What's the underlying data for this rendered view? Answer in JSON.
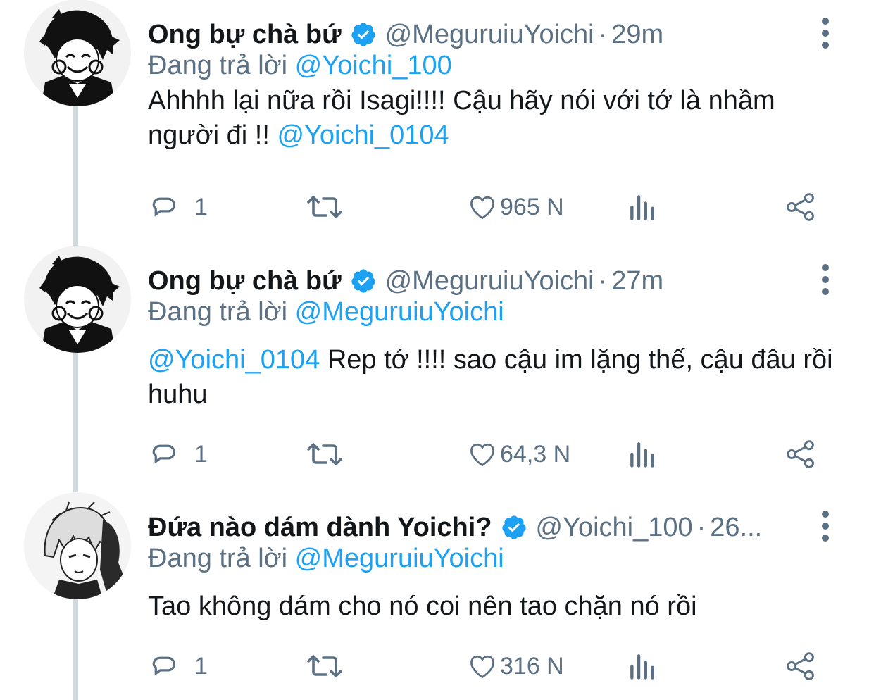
{
  "tweets": [
    {
      "display_name": "Ong bự chà bứ",
      "verified_icon": "verified-badge-icon",
      "handle": "@MeguruiuYoichi",
      "separator": "·",
      "time": "29m",
      "reply_prefix": "Đang trả lời",
      "reply_to": "@Yoichi_100",
      "body_text": "Ahhhh lại nữa rồi Isagi!!!! Cậu hãy nói với tớ là nhầm người đi !! ",
      "body_mention_leading": "",
      "body_mention_trailing": "@Yoichi_0104",
      "reply_count": "1",
      "retweet_count": "",
      "like_count": "965 N"
    },
    {
      "display_name": "Ong bự chà bứ",
      "verified_icon": "verified-badge-icon",
      "handle": "@MeguruiuYoichi",
      "separator": "·",
      "time": "27m",
      "reply_prefix": "Đang trả lời",
      "reply_to": "@MeguruiuYoichi",
      "body_mention_leading": "@Yoichi_0104",
      "body_text": " Rep tớ !!!! sao cậu im lặng thế, cậu đâu rồi huhu",
      "body_mention_trailing": "",
      "reply_count": "1",
      "retweet_count": "",
      "like_count": "64,3 N"
    },
    {
      "display_name": "Đứa nào dám dành Yoichi?",
      "verified_icon": "verified-badge-icon",
      "handle": "@Yoichi_100",
      "separator": "·",
      "time": "26...",
      "reply_prefix": "Đang trả lời",
      "reply_to": "@MeguruiuYoichi",
      "body_mention_leading": "",
      "body_text": "Tao không dám cho nó coi nên tao chặn nó rồi",
      "body_mention_trailing": "",
      "reply_count": "1",
      "retweet_count": "",
      "like_count": "316 N"
    }
  ],
  "icons": {
    "reply": "comment-bubble-icon",
    "retweet": "retweet-icon",
    "like": "heart-icon",
    "stats": "analytics-bars-icon",
    "share": "share-icon",
    "more": "more-vertical-icon"
  },
  "colors": {
    "text": "#14171a",
    "muted": "#5b7083",
    "link": "#1da1f2",
    "verified": "#1da1f2",
    "thread_line": "#cfd9de"
  }
}
